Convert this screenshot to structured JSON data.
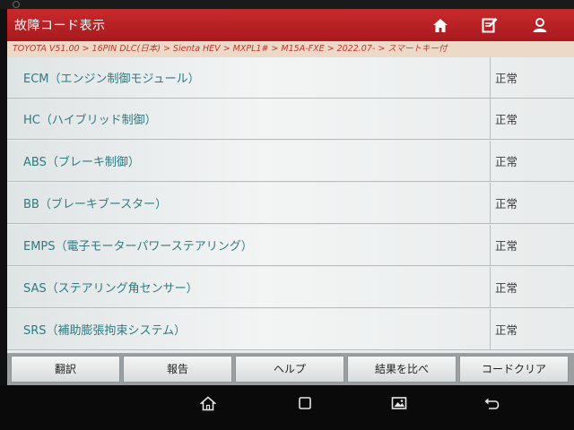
{
  "header": {
    "title": "故障コード表示"
  },
  "breadcrumb": "TOYOTA V51.00 > 16PIN DLC(日本) > Sienta HEV > MXPL1# > M15A-FXE > 2022.07- > スマートキー付",
  "systems": [
    {
      "name": "ECM（エンジン制御モジュール）",
      "status": "正常"
    },
    {
      "name": "HC（ハイブリッド制御）",
      "status": "正常"
    },
    {
      "name": "ABS（ブレーキ制御）",
      "status": "正常"
    },
    {
      "name": "BB（ブレーキブースター）",
      "status": "正常"
    },
    {
      "name": "EMPS（電子モーターパワーステアリング）",
      "status": "正常"
    },
    {
      "name": "SAS（ステアリング角センサー）",
      "status": "正常"
    },
    {
      "name": "SRS（補助膨張拘束システム）",
      "status": "正常"
    }
  ],
  "buttons": {
    "translate": "翻訳",
    "report": "報告",
    "help": "ヘルプ",
    "compare": "結果を比べ",
    "clear_codes": "コードクリア"
  },
  "icons": {
    "header": [
      "home-icon",
      "report-icon",
      "user-icon"
    ],
    "nav": [
      "android-home-icon",
      "recent-apps-icon",
      "gallery-icon",
      "back-icon"
    ]
  },
  "colors": {
    "title_bar": "#b82226",
    "breadcrumb_text": "#c0392b",
    "system_name": "#2f7a80"
  }
}
